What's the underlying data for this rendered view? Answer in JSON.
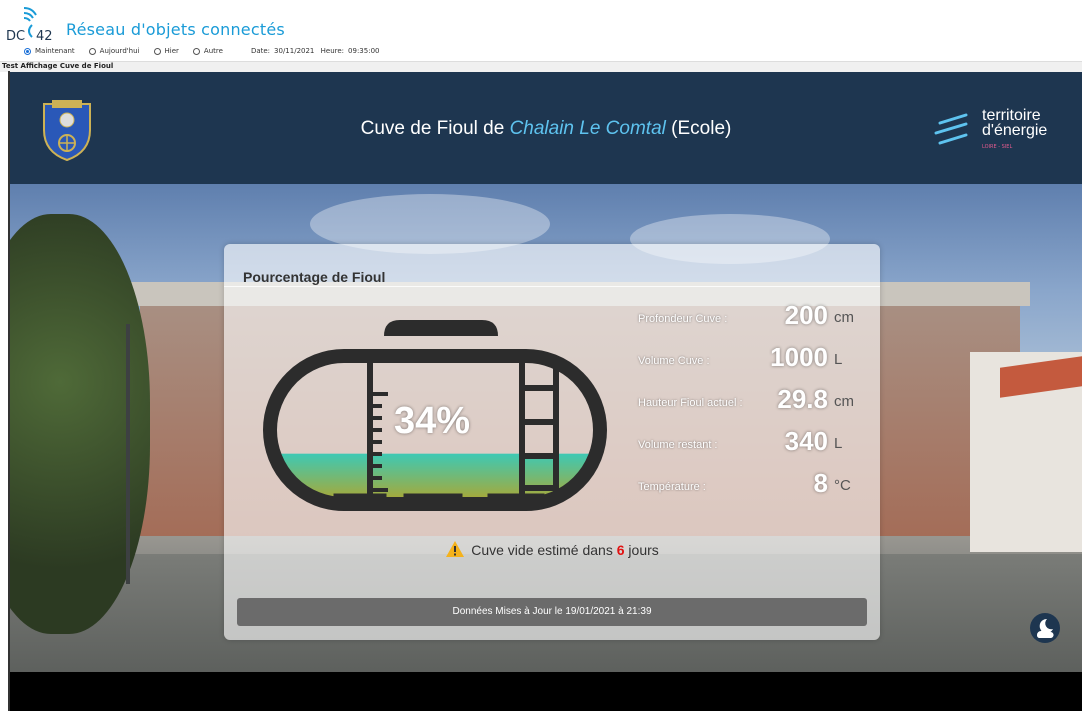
{
  "header": {
    "logo_text": "DC 42",
    "app_title": "Réseau d'objets connectés",
    "radio_options": [
      "Maintenant",
      "Aujourd'hui",
      "Hier",
      "Autre"
    ],
    "selected_option": "Maintenant",
    "date_label": "Date:",
    "date_value": "30/11/2021",
    "time_label": "Heure:",
    "time_value": "09:35:00",
    "subtitle": "Test Affichage Cuve de Fioul"
  },
  "banner": {
    "title_prefix": "Cuve de Fioul de ",
    "title_place": "Chalain Le Comtal",
    "title_suffix": " (Ecole)",
    "brand_line1": "territoire",
    "brand_line2": "d'énergie",
    "brand_sub": "LOIRE - SIEL"
  },
  "card": {
    "title": "Pourcentage de Fioul",
    "percentage": "34%",
    "fill_fraction": 0.34,
    "stats": [
      {
        "label": "Profondeur Cuve :",
        "value": "200",
        "unit": "cm"
      },
      {
        "label": "Volume Cuve :",
        "value": "1000",
        "unit": "L"
      },
      {
        "label": "Hauteur Fioul actuel :",
        "value": "29.8",
        "unit": "cm"
      },
      {
        "label": "Volume restant :",
        "value": "340",
        "unit": "L"
      },
      {
        "label": "Température :",
        "value": "8",
        "unit": "°C"
      }
    ],
    "warning_prefix": "Cuve vide estimé dans ",
    "warning_days": "6",
    "warning_suffix": " jours",
    "update_text": "Données Mises à Jour le 19/01/2021 à 21:39"
  },
  "colors": {
    "banner_bg": "#1e3650",
    "accent": "#1a9bd7",
    "fuel_top": "#3ec9b4",
    "fuel_bottom": "#b3a52a",
    "warning_days": "#e11111"
  },
  "icons": {
    "corner": "weather-moon-cloud-icon",
    "warning": "warning-triangle-icon"
  }
}
